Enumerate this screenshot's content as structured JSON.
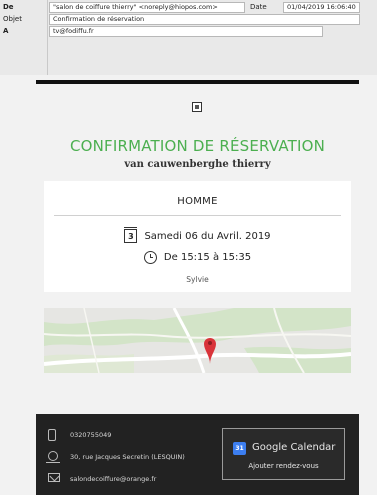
{
  "header": {
    "from_label": "De",
    "from_value": "\"salon de coiffure thierry\" <noreply@hiopos.com>",
    "date_label": "Date",
    "date_value": "01/04/2019 16:06:40",
    "subject_label": "Objet",
    "subject_value": "Confirmation de réservation",
    "to_label": "A",
    "to_value": "tv@fodiffu.fr"
  },
  "body": {
    "title": "CONFIRMATION DE RÉSERVATION",
    "subtitle": "van cauwenberghe thierry",
    "service": "HOMME",
    "date_icon_number": "3",
    "date": "Samedi 06 du Avril. 2019",
    "time": "De 15:15 à 15:35",
    "staff": "Sylvie"
  },
  "footer": {
    "phone": "0320755049",
    "address": "30, rue Jacques Secretin (LESQUIN)",
    "email": "salondecoiffure@orange.fr",
    "calendar_title": "Google Calendar",
    "calendar_icon": "31",
    "calendar_action": "Ajouter rendez-vous"
  },
  "icons": {
    "broken_image": "broken-image-icon",
    "calendar": "calendar-icon",
    "clock": "clock-icon",
    "map_pin": "map-pin-icon",
    "phone": "phone-icon",
    "location": "location-icon",
    "mail": "mail-icon",
    "google_calendar": "google-calendar-icon"
  },
  "colors": {
    "accent": "#4caf50",
    "map_pin": "#d9343a",
    "footer_bg": "#222222",
    "gcal_blue": "#3c7ef0"
  }
}
